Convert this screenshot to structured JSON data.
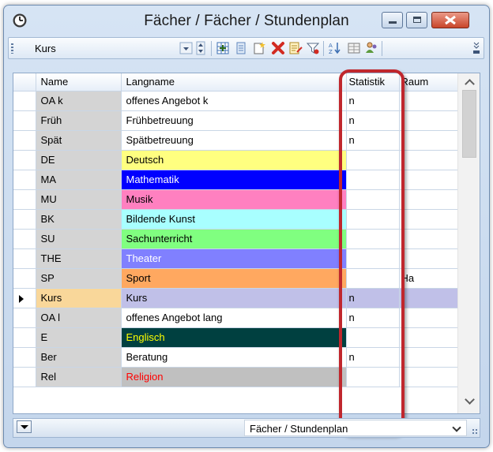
{
  "window": {
    "title": "Fächer / Fächer / Stundenplan"
  },
  "toolbar": {
    "selector_value": "Kurs"
  },
  "grid": {
    "columns": [
      "Name",
      "Langname",
      "Statistik",
      "Raum"
    ],
    "rows": [
      {
        "name": "OA k",
        "langname": "offenes Angebot k",
        "statistik": "n",
        "raum": "",
        "bg": "#ffffff",
        "fg": "#000000"
      },
      {
        "name": "Früh",
        "langname": "Frühbetreuung",
        "statistik": "n",
        "raum": "",
        "bg": "#ffffff",
        "fg": "#000000"
      },
      {
        "name": "Spät",
        "langname": "Spätbetreuung",
        "statistik": "n",
        "raum": "",
        "bg": "#ffffff",
        "fg": "#000000"
      },
      {
        "name": "DE",
        "langname": "Deutsch",
        "statistik": "",
        "raum": "",
        "bg": "#ffff80",
        "fg": "#000000"
      },
      {
        "name": "MA",
        "langname": "Mathematik",
        "statistik": "",
        "raum": "",
        "bg": "#0000ff",
        "fg": "#ffffff"
      },
      {
        "name": "MU",
        "langname": "Musik",
        "statistik": "",
        "raum": "",
        "bg": "#ff80c0",
        "fg": "#000000"
      },
      {
        "name": "BK",
        "langname": "Bildende Kunst",
        "statistik": "",
        "raum": "",
        "bg": "#a8ffff",
        "fg": "#000000"
      },
      {
        "name": "SU",
        "langname": "Sachunterricht",
        "statistik": "",
        "raum": "",
        "bg": "#80ff80",
        "fg": "#000000"
      },
      {
        "name": "THE",
        "langname": "Theater",
        "statistik": "",
        "raum": "",
        "bg": "#8080ff",
        "fg": "#ffffff"
      },
      {
        "name": "SP",
        "langname": "Sport",
        "statistik": "",
        "raum": "Ha",
        "bg": "#ffa860",
        "fg": "#000000"
      },
      {
        "name": "Kurs",
        "langname": "Kurs",
        "statistik": "n",
        "raum": "",
        "bg": "#c0c0e8",
        "fg": "#000000",
        "current": true
      },
      {
        "name": "OA l",
        "langname": "offenes Angebot lang",
        "statistik": "n",
        "raum": "",
        "bg": "#ffffff",
        "fg": "#000000"
      },
      {
        "name": "E",
        "langname": "Englisch",
        "statistik": "",
        "raum": "",
        "bg": "#004040",
        "fg": "#ffff00"
      },
      {
        "name": "Ber",
        "langname": "Beratung",
        "statistik": "n",
        "raum": "",
        "bg": "#ffffff",
        "fg": "#000000"
      },
      {
        "name": "Rel",
        "langname": "Religion",
        "statistik": "",
        "raum": "",
        "bg": "#c0c0c0",
        "fg": "#ff0000"
      }
    ]
  },
  "statusbar": {
    "view_value": "Fächer / Stundenplan"
  },
  "colors": {
    "highlight_ring": "#c0272d",
    "current_row_name": "#f9d79a"
  }
}
